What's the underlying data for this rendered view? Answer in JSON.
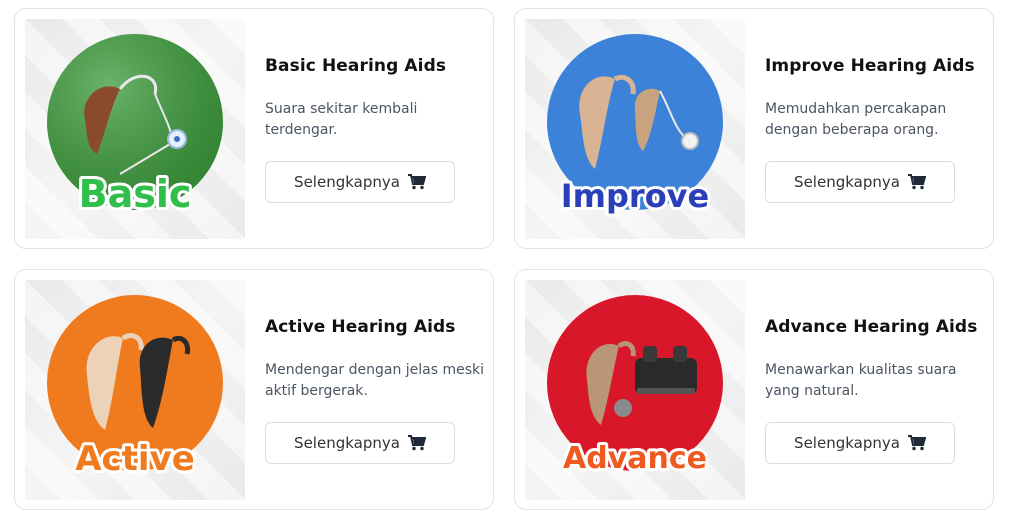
{
  "cards": [
    {
      "title": "Basic Hearing Aids",
      "description": "Suara sekitar kembali terdengar.",
      "button_label": "Selengkapnya",
      "image_word": "Basic",
      "circle_color": "#3a9a3a",
      "word_color": "#2fbf4a"
    },
    {
      "title": "Improve Hearing Aids",
      "description": "Memudahkan percakapan dengan beberapa orang.",
      "button_label": "Selengkapnya",
      "image_word": "Improve",
      "circle_color": "#3b82d8",
      "word_color": "#2b3fb8"
    },
    {
      "title": "Active Hearing Aids",
      "description": "Mendengar dengan jelas meski aktif bergerak.",
      "button_label": "Selengkapnya",
      "image_word": "Active",
      "circle_color": "#f07a1e",
      "word_color": "#f07a1e"
    },
    {
      "title": "Advance Hearing Aids",
      "description": "Menawarkan kualitas suara yang natural.",
      "button_label": "Selengkapnya",
      "image_word": "Advance",
      "circle_color": "#d8182a",
      "word_color": "#ef5a20"
    }
  ],
  "icons": {
    "button_icon": "shopping-cart-icon"
  }
}
